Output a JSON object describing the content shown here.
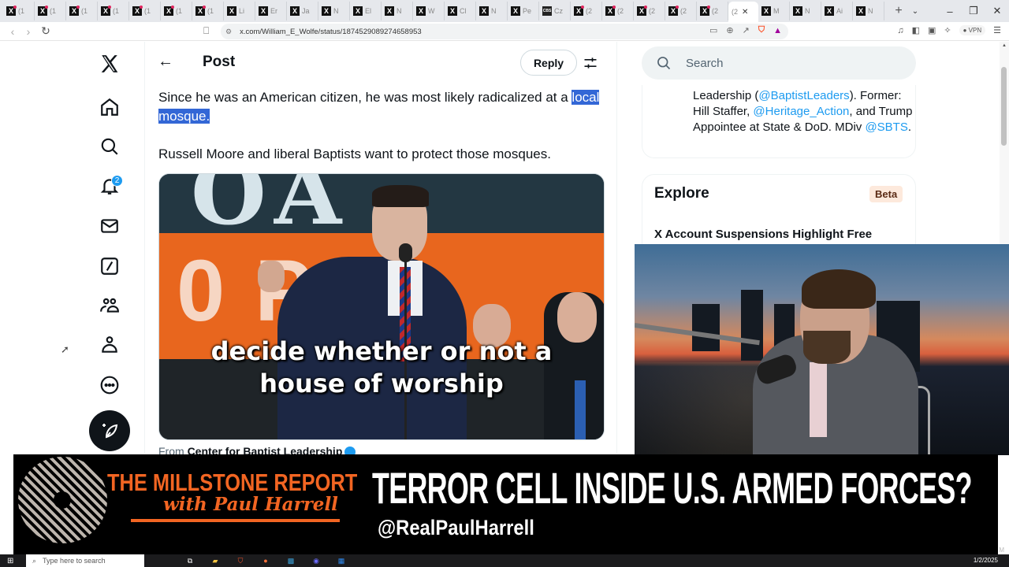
{
  "browser": {
    "tabs": [
      {
        "label": "(1",
        "icon": "x-logo",
        "notify": true
      },
      {
        "label": "(1",
        "icon": "x-logo",
        "notify": true
      },
      {
        "label": "(1",
        "icon": "x-logo",
        "notify": true
      },
      {
        "label": "(1",
        "icon": "x-logo",
        "notify": true
      },
      {
        "label": "(1",
        "icon": "x-logo",
        "notify": true
      },
      {
        "label": "(1",
        "icon": "x-logo",
        "notify": true
      },
      {
        "label": "(1",
        "icon": "x-logo",
        "notify": true
      },
      {
        "label": "Li",
        "icon": "x-logo",
        "notify": false
      },
      {
        "label": "Er",
        "icon": "x-logo",
        "notify": false
      },
      {
        "label": "Ja",
        "icon": "x-logo",
        "notify": false
      },
      {
        "label": "N",
        "icon": "x-logo",
        "notify": false
      },
      {
        "label": "El",
        "icon": "x-logo",
        "notify": false
      },
      {
        "label": "N",
        "icon": "x-logo",
        "notify": false
      },
      {
        "label": "W",
        "icon": "x-logo",
        "notify": false
      },
      {
        "label": "Cl",
        "icon": "x-logo",
        "notify": false
      },
      {
        "label": "N",
        "icon": "x-logo",
        "notify": false
      },
      {
        "label": "Pe",
        "icon": "x-logo",
        "notify": false
      },
      {
        "label": "Cz",
        "icon": "cbs-logo",
        "notify": false
      },
      {
        "label": "(2",
        "icon": "x-logo",
        "notify": true
      },
      {
        "label": "(2",
        "icon": "x-logo",
        "notify": true
      },
      {
        "label": "(2",
        "icon": "x-logo",
        "notify": true
      },
      {
        "label": "(2",
        "icon": "x-logo",
        "notify": true
      },
      {
        "label": "(2",
        "icon": "x-logo",
        "notify": true
      },
      {
        "label": "(2",
        "icon": "none",
        "notify": false,
        "active": true
      },
      {
        "label": "M",
        "icon": "x-logo",
        "notify": false
      },
      {
        "label": "N",
        "icon": "x-logo",
        "notify": false
      },
      {
        "label": "Ai",
        "icon": "x-logo",
        "notify": false
      },
      {
        "label": "N",
        "icon": "x-logo",
        "notify": false
      }
    ],
    "new_tab": "+",
    "url": "x.com/William_E_Wolfe/status/1874529089274658953",
    "vpn_label": "VPN"
  },
  "nav": {
    "notification_count": "2",
    "items": [
      "home",
      "explore",
      "notifications",
      "messages",
      "grok",
      "communities",
      "profile",
      "more"
    ]
  },
  "header": {
    "back": "←",
    "title": "Post",
    "reply_label": "Reply"
  },
  "post": {
    "text_before_selection": "Since he was an American citizen, he was most likely radicalized at a ",
    "text_selected": "local mosque.",
    "text_second": "Russell Moore and liberal Baptists want to protect those mosques.",
    "video_caption_line1": "decide whether or not a",
    "video_caption_line2": "house of worship",
    "from_prefix": "From ",
    "from_source": "Center for Baptist Leadership"
  },
  "sidebar": {
    "search_placeholder": "Search",
    "bio": {
      "p1": "Leadership (",
      "link1": "@BaptistLeaders",
      "p2": "). Former: Hill Staffer, ",
      "link2": "@Heritage_Action",
      "p3": ", and Trump Appointee at State & DoD. MDiv ",
      "link3": "@SBTS",
      "p4": "."
    },
    "explore_title": "Explore",
    "explore_badge": "Beta",
    "explore_item": "X Account Suspensions Highlight Free Speech Debate"
  },
  "overlay": {
    "show_title": "THE MILLSTONE REPORT",
    "show_subtitle": "with Paul Harrell",
    "headline": "TERROR CELL INSIDE U.S. ARMED FORCES?",
    "handle": "@RealPaulHarrell",
    "accent_color": "#f26522"
  },
  "taskbar": {
    "search_placeholder": "Type here to search",
    "tray_partial": "M",
    "date": "1/2/2025"
  }
}
